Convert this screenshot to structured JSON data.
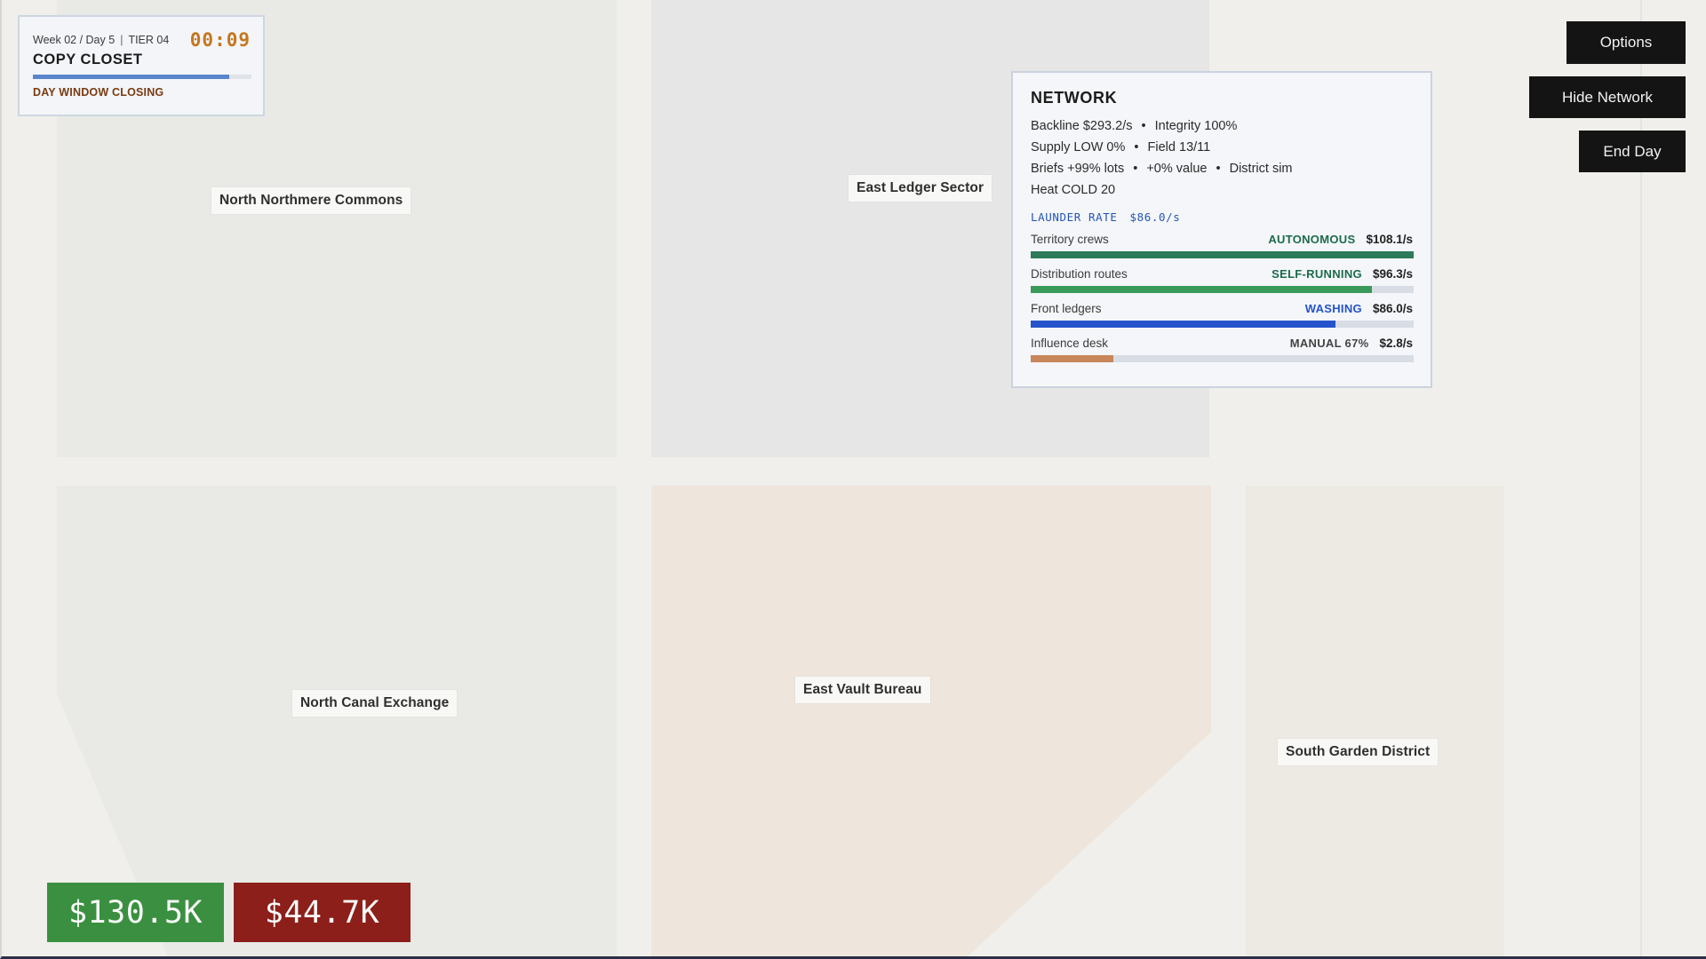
{
  "status": {
    "week_day": "Week 02 / Day 5",
    "separator": "|",
    "tier": "TIER 04",
    "timer": "00:09",
    "location": "COPY CLOSET",
    "day_progress": 0.9,
    "warning": "DAY WINDOW CLOSING",
    "progress_color": "#5a86cc",
    "timer_color": "#c4771f"
  },
  "map": {
    "districts": [
      {
        "name": "North Northmere Commons"
      },
      {
        "name": "East Ledger Sector"
      },
      {
        "name": "North Canal Exchange"
      },
      {
        "name": "East Vault Bureau"
      },
      {
        "name": "South Garden District"
      }
    ]
  },
  "buttons": {
    "options": "Options",
    "hide_network": "Hide Network",
    "end_day": "End Day"
  },
  "network": {
    "title": "NETWORK",
    "lines": {
      "backline_label": "Backline",
      "backline_value": "$293.2/s",
      "integrity_label": "Integrity",
      "integrity_value": "100%",
      "supply_label": "Supply",
      "supply_value": "LOW 0%",
      "field_label": "Field",
      "field_value": "13/11",
      "briefs_label": "Briefs",
      "briefs_lots": "+99% lots",
      "briefs_value": "+0% value",
      "briefs_sim": "District sim",
      "heat_label": "Heat",
      "heat_value": "COLD 20",
      "bullet": "•"
    },
    "launder_label": "LAUNDER RATE",
    "launder_value": "$86.0/s",
    "rows": [
      {
        "label": "Territory crews",
        "status": "AUTONOMOUS",
        "rate": "$108.1/s",
        "fill": 1.0,
        "color": "#2c7a5a",
        "status_color": "#1d6b4a"
      },
      {
        "label": "Distribution routes",
        "status": "SELF-RUNNING",
        "rate": "$96.3/s",
        "fill": 0.89,
        "color": "#3a9a5a",
        "status_color": "#1d6b4a"
      },
      {
        "label": "Front ledgers",
        "status": "WASHING",
        "rate": "$86.0/s",
        "fill": 0.795,
        "color": "#2553c9",
        "status_color": "#2553c9"
      },
      {
        "label": "Influence desk",
        "status": "MANUAL 67%",
        "rate": "$2.8/s",
        "fill": 0.215,
        "color": "#c8875a",
        "status_color": "#444444"
      }
    ]
  },
  "money": {
    "cash": "$130.5K",
    "debt": "$44.7K",
    "cash_color": "#3a9040",
    "debt_color": "#8c1f1a"
  }
}
